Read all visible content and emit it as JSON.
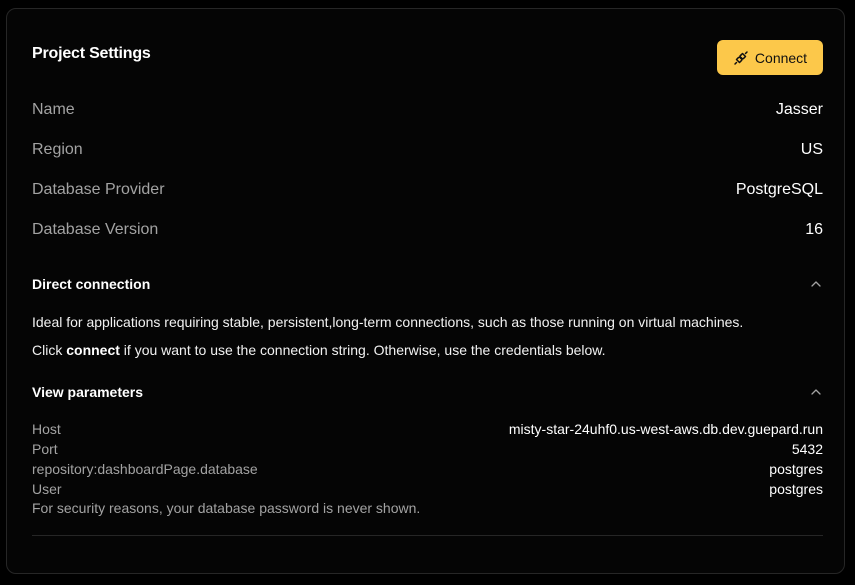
{
  "card": {
    "title": "Project Settings",
    "connect_label": "Connect",
    "accent": "#fcc84a"
  },
  "info": [
    {
      "key": "Name",
      "value": "Jasser"
    },
    {
      "key": "Region",
      "value": "US"
    },
    {
      "key": "Database Provider",
      "value": "PostgreSQL"
    },
    {
      "key": "Database Version",
      "value": "16"
    }
  ],
  "direct_connection": {
    "title": "Direct connection",
    "description": "Ideal for applications requiring stable, persistent,long-term connections, such as those running on virtual machines.",
    "hint_prefix": "Click ",
    "hint_bold": "connect",
    "hint_suffix": " if you want to use the connection string. Otherwise, use the credentials below."
  },
  "parameters": {
    "title": "View parameters",
    "rows": [
      {
        "key": "Host",
        "value": "misty-star-24uhf0.us-west-aws.db.dev.guepard.run"
      },
      {
        "key": "Port",
        "value": "5432"
      },
      {
        "key": "repository:dashboardPage.database",
        "value": "postgres"
      },
      {
        "key": "User",
        "value": "postgres"
      }
    ],
    "note": "For security reasons, your database password is never shown."
  },
  "icons": {
    "connect": "plug-icon",
    "collapse": "chevron-up-icon"
  }
}
